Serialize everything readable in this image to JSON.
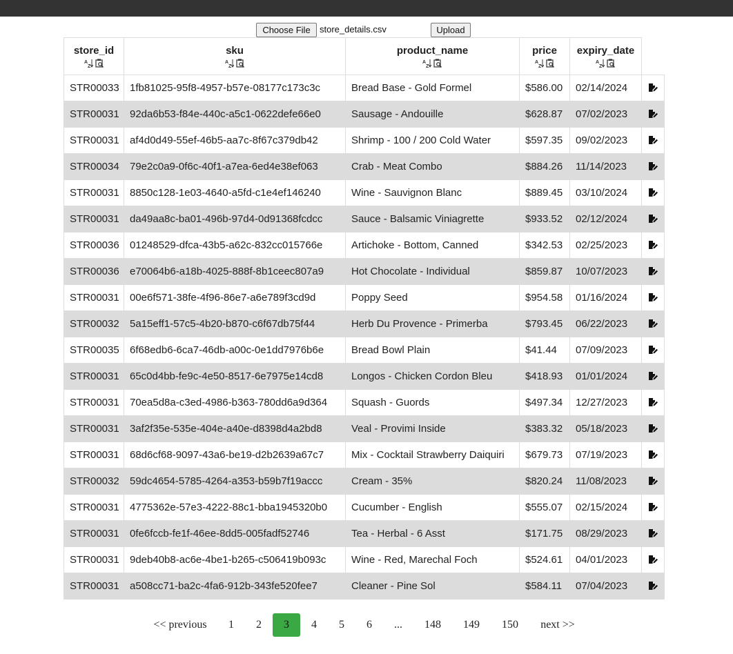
{
  "upload": {
    "choose_label": "Choose File",
    "file_name": "store_details.csv",
    "upload_label": "Upload"
  },
  "table": {
    "columns": [
      "store_id",
      "sku",
      "product_name",
      "price",
      "expiry_date"
    ],
    "rows": [
      [
        "STR00033",
        "1fb81025-95f8-4957-b57e-08177c173c3c",
        "Bread Base - Gold Formel",
        "$586.00",
        "02/14/2024"
      ],
      [
        "STR00031",
        "92da6b53-f84e-440c-a5c1-0622defe66e0",
        "Sausage - Andouille",
        "$628.87",
        "07/02/2023"
      ],
      [
        "STR00031",
        "af4d0d49-55ef-46b5-aa7c-8f67c379db42",
        "Shrimp - 100 / 200 Cold Water",
        "$597.35",
        "09/02/2023"
      ],
      [
        "STR00034",
        "79e2c0a9-0f6c-40f1-a7ea-6ed4e38ef063",
        "Crab - Meat Combo",
        "$884.26",
        "11/14/2023"
      ],
      [
        "STR00031",
        "8850c128-1e03-4640-a5fd-c1e4ef146240",
        "Wine - Sauvignon Blanc",
        "$889.45",
        "03/10/2024"
      ],
      [
        "STR00031",
        "da49aa8c-ba01-496b-97d4-0d91368fcdcc",
        "Sauce - Balsamic Viniagrette",
        "$933.52",
        "02/12/2024"
      ],
      [
        "STR00036",
        "01248529-dfca-43b5-a62c-832cc015766e",
        "Artichoke - Bottom, Canned",
        "$342.53",
        "02/25/2023"
      ],
      [
        "STR00036",
        "e70064b6-a18b-4025-888f-8b1ceec807a9",
        "Hot Chocolate - Individual",
        "$859.87",
        "10/07/2023"
      ],
      [
        "STR00031",
        "00e6f571-38fe-4f96-86e7-a6e789f3cd9d",
        "Poppy Seed",
        "$954.58",
        "01/16/2024"
      ],
      [
        "STR00032",
        "5a15eff1-57c5-4b20-b870-c6f67db75f44",
        "Herb Du Provence - Primerba",
        "$793.45",
        "06/22/2023"
      ],
      [
        "STR00035",
        "6f68edb6-6ca7-46db-a00c-0e1dd7976b6e",
        "Bread Bowl Plain",
        "$41.44",
        "07/09/2023"
      ],
      [
        "STR00031",
        "65c0d4bb-fe9c-4e50-8517-6e7975e14cd8",
        "Longos - Chicken Cordon Bleu",
        "$418.93",
        "01/01/2024"
      ],
      [
        "STR00031",
        "70ea5d8a-c3ed-4986-b363-780dd6a9d364",
        "Squash - Guords",
        "$497.34",
        "12/27/2023"
      ],
      [
        "STR00031",
        "3af2f35e-535e-404e-a40e-d8398d4a2bd8",
        "Veal - Provimi Inside",
        "$383.32",
        "05/18/2023"
      ],
      [
        "STR00031",
        "68d6cf68-9097-43a6-be19-d2b2639a67c7",
        "Mix - Cocktail Strawberry Daiquiri",
        "$679.73",
        "07/19/2023"
      ],
      [
        "STR00032",
        "59dc4654-5785-4264-a353-b59b7f19accc",
        "Cream - 35%",
        "$820.24",
        "11/08/2023"
      ],
      [
        "STR00031",
        "4775362e-57e3-4222-88c1-bba1945320b0",
        "Cucumber - English",
        "$555.07",
        "02/15/2024"
      ],
      [
        "STR00031",
        "0fe6fccb-fe1f-46ee-8dd5-005fadf52746",
        "Tea - Herbal - 6 Asst",
        "$171.75",
        "08/29/2023"
      ],
      [
        "STR00031",
        "9deb40b8-ac6e-4be1-b265-c506419b093c",
        "Wine - Red, Marechal Foch",
        "$524.61",
        "04/01/2023"
      ],
      [
        "STR00031",
        "a508cc71-ba2c-4fa6-912b-343fe520fee7",
        "Cleaner - Pine Sol",
        "$584.11",
        "07/04/2023"
      ]
    ],
    "sort_icon": "sort-alpha-icon",
    "filter_icon": "filter-search-icon",
    "row_action_icon": "edit-icon"
  },
  "pagination": {
    "items": [
      "<< previous",
      "1",
      "2",
      "3",
      "4",
      "5",
      "6",
      "...",
      "148",
      "149",
      "150",
      "next >>"
    ],
    "active_page": "3",
    "active_color": "#3aa843"
  }
}
